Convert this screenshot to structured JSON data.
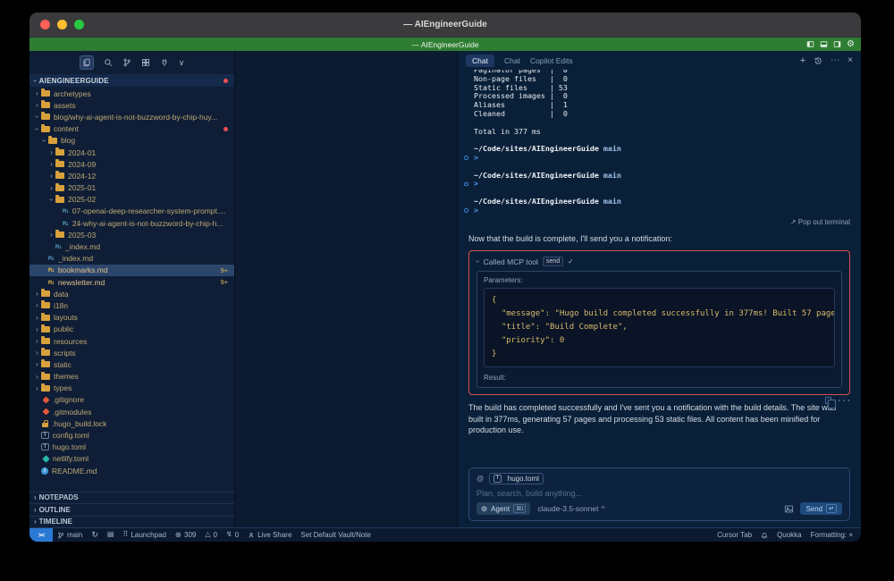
{
  "window": {
    "titlebar_title": "— AIEngineerGuide",
    "menubar_title": "— AIEngineerGuide",
    "menubar_icons": [
      "layout-left-icon",
      "layout-bottom-icon",
      "layout-right-icon",
      "gear-icon"
    ],
    "accent_green": "#2e7d32",
    "highlight_red": "#e14b4b"
  },
  "sidebar": {
    "toolbar_icons": [
      "files-icon",
      "search-icon",
      "source-control-icon",
      "extensions-icon",
      "plug-icon",
      "chevron-down-icon"
    ],
    "section_title": "AIENGINEERGUIDE",
    "tree": [
      {
        "label": "archetypes",
        "depth": 0,
        "expand": "closed",
        "icon": "folder-icon"
      },
      {
        "label": "assets",
        "depth": 0,
        "expand": "closed",
        "icon": "folder-icon"
      },
      {
        "label": "blog/why-ai-agent-is-not-buzzword-by-chip-huy...",
        "depth": 0,
        "expand": "open",
        "icon": "folder-icon"
      },
      {
        "label": "content",
        "depth": 0,
        "expand": "open",
        "icon": "folder-icon",
        "dot": true
      },
      {
        "label": "blog",
        "depth": 1,
        "expand": "open",
        "icon": "folder-icon"
      },
      {
        "label": "2024-01",
        "depth": 2,
        "expand": "closed",
        "icon": "folder-icon"
      },
      {
        "label": "2024-09",
        "depth": 2,
        "expand": "closed",
        "icon": "folder-icon"
      },
      {
        "label": "2024-12",
        "depth": 2,
        "expand": "closed",
        "icon": "folder-icon"
      },
      {
        "label": "2025-01",
        "depth": 2,
        "expand": "closed",
        "icon": "folder-icon"
      },
      {
        "label": "2025-02",
        "depth": 2,
        "expand": "open",
        "icon": "folder-icon"
      },
      {
        "label": "07-openai-deep-researcher-system-prompt....",
        "depth": 3,
        "icon": "markdown-icon",
        "icon_color": "blue"
      },
      {
        "label": "24-why-ai-agent-is-not-buzzword-by-chip-h...",
        "depth": 3,
        "icon": "markdown-icon",
        "icon_color": "blue"
      },
      {
        "label": "2025-03",
        "depth": 2,
        "expand": "closed",
        "icon": "folder-icon"
      },
      {
        "label": "_index.md",
        "depth": 2,
        "icon": "markdown-icon",
        "icon_color": "blue"
      },
      {
        "label": "_index.md",
        "depth": 1,
        "icon": "markdown-icon",
        "icon_color": "blue"
      },
      {
        "label": "bookmarks.md",
        "depth": 1,
        "icon": "markdown-icon",
        "icon_color": "gold",
        "selected": true,
        "modified": true,
        "badge": "9+"
      },
      {
        "label": "newsletter.md",
        "depth": 1,
        "icon": "markdown-icon",
        "icon_color": "gold",
        "modified": true,
        "badge": "9+"
      },
      {
        "label": "data",
        "depth": 0,
        "expand": "closed",
        "icon": "folder-icon"
      },
      {
        "label": "i18n",
        "depth": 0,
        "expand": "closed",
        "icon": "folder-icon"
      },
      {
        "label": "layouts",
        "depth": 0,
        "expand": "closed",
        "icon": "folder-icon"
      },
      {
        "label": "public",
        "depth": 0,
        "expand": "closed",
        "icon": "folder-icon"
      },
      {
        "label": "resources",
        "depth": 0,
        "expand": "closed",
        "icon": "folder-icon"
      },
      {
        "label": "scripts",
        "depth": 0,
        "expand": "closed",
        "icon": "folder-icon"
      },
      {
        "label": "static",
        "depth": 0,
        "expand": "closed",
        "icon": "folder-icon"
      },
      {
        "label": "themes",
        "depth": 0,
        "expand": "closed",
        "icon": "folder-icon"
      },
      {
        "label": "types",
        "depth": 0,
        "expand": "closed",
        "icon": "folder-icon"
      },
      {
        "label": ".gitignore",
        "depth": 0,
        "icon": "git-icon"
      },
      {
        "label": ".gitmodules",
        "depth": 0,
        "icon": "git-icon"
      },
      {
        "label": ".hugo_build.lock",
        "depth": 0,
        "icon": "lock-icon"
      },
      {
        "label": "config.toml",
        "depth": 0,
        "icon": "toml-icon"
      },
      {
        "label": "hugo.toml",
        "depth": 0,
        "icon": "toml-icon"
      },
      {
        "label": "netlify.toml",
        "depth": 0,
        "icon": "netlify-icon"
      },
      {
        "label": "README.md",
        "depth": 0,
        "icon": "info-icon"
      }
    ],
    "bottom_sections": [
      "NOTEPADS",
      "OUTLINE",
      "TIMELINE"
    ]
  },
  "chat": {
    "tabs": [
      {
        "label": "Chat",
        "active": true
      },
      {
        "label": "Chat",
        "active": false
      },
      {
        "label": "Copilot Edits",
        "active": false
      }
    ],
    "header_icons": [
      "plus-icon",
      "history-icon",
      "ellipsis-icon",
      "close-icon"
    ],
    "terminal": {
      "stats": [
        "Paginator pages  |  0",
        "Non-page files   |  0",
        "Static files     | 53",
        "Processed images |  0",
        "Aliases          |  1",
        "Cleaned          |  0"
      ],
      "total_line": "Total in 377 ms",
      "prompts": [
        {
          "path": "~/Code/sites/AIEngineerGuide",
          "branch": "main"
        },
        {
          "path": "~/Code/sites/AIEngineerGuide",
          "branch": "main"
        },
        {
          "path": "~/Code/sites/AIEngineerGuide",
          "branch": "main"
        }
      ],
      "prompt_char": ">",
      "popout_label": "Pop out terminal"
    },
    "message1": "Now that the build is complete, I'll send you a notification:",
    "tool_call": {
      "label": "Called MCP tool",
      "badge": "send",
      "check": "✓",
      "params_label": "Parameters:",
      "code_lines": [
        "{",
        "  \"message\": \"Hugo build completed successfully in 377ms! Built 57 page",
        "  \"title\": \"Build Complete\",",
        "  \"priority\": 0",
        "}"
      ],
      "result_label": "Result:"
    },
    "message2": "The build has completed successfully and I've sent you a notification with the build details. The site was built in 377ms, generating 57 pages and processing 53 static files. All content has been minified for production use.",
    "input": {
      "context_chip": "hugo.toml",
      "placeholder": "Plan, search, build anything...",
      "agent_label": "Agent",
      "agent_shortcut": "⌘I",
      "model": "claude-3.5-sonnet",
      "send_label": "Send",
      "send_shortcut": "↵"
    }
  },
  "statusbar": {
    "remote_glyph": "><",
    "left": [
      {
        "icon": "git-branch-icon",
        "label": "main"
      },
      {
        "icon": "sync-icon",
        "label": ""
      },
      {
        "icon": "keyboard-icon",
        "label": ""
      },
      {
        "icon": "launchpad-icon",
        "label": "Launchpad"
      },
      {
        "icon": "error-icon",
        "label": "309"
      },
      {
        "icon": "warning-icon",
        "label": "0"
      },
      {
        "icon": "port-icon",
        "label": "0"
      },
      {
        "icon": "live-share-icon",
        "label": "Live Share"
      },
      {
        "icon": "",
        "label": "Set Default Vault/Note"
      }
    ],
    "right": [
      {
        "icon": "",
        "label": "Cursor Tab"
      },
      {
        "icon": "bell-icon",
        "label": ""
      },
      {
        "icon": "",
        "label": "Quokka"
      },
      {
        "icon": "",
        "label": "Formatting: ×"
      }
    ]
  }
}
